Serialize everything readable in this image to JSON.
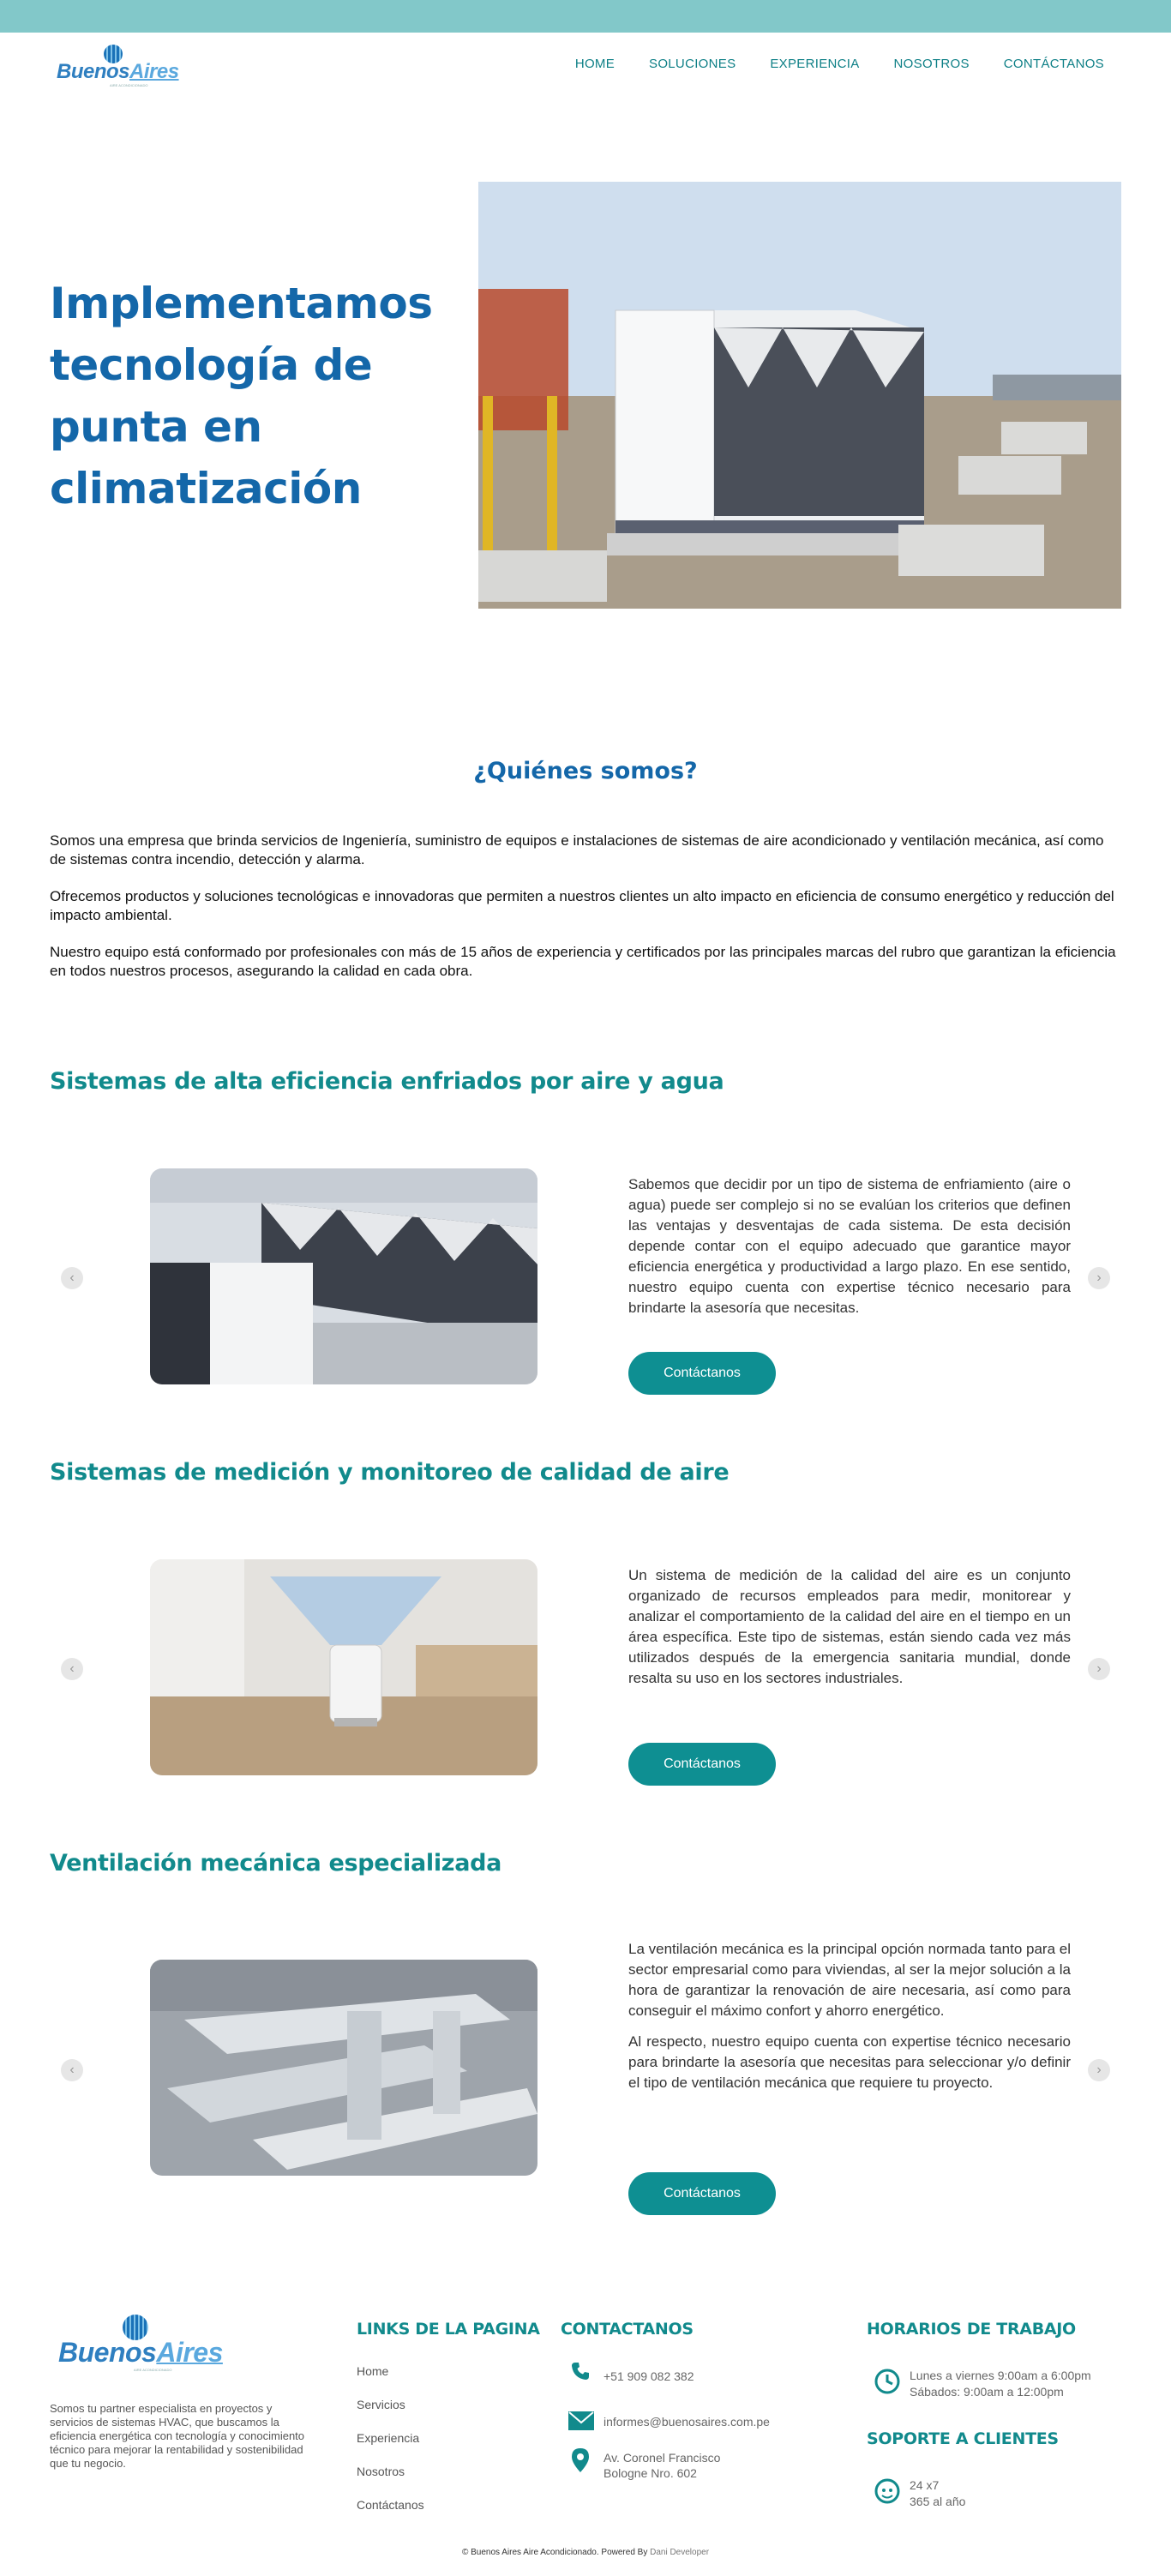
{
  "brand": {
    "name_part1": "Buenos",
    "name_part2": "Aires",
    "tagline": "AIRE ACONDICIONADO"
  },
  "nav": {
    "items": [
      "HOME",
      "SOLUCIONES",
      "EXPERIENCIA",
      "NOSOTROS",
      "CONTÁCTANOS"
    ]
  },
  "hero": {
    "title": "Implementamos tecnología de punta en climatización"
  },
  "about": {
    "title": "¿Quiénes somos?",
    "paragraphs": [
      "Somos una empresa que brinda servicios de Ingeniería, suministro de equipos e instalaciones de sistemas de aire acondicionado y ventilación mecánica, así como de sistemas contra incendio, detección y alarma.",
      "Ofrecemos productos y soluciones tecnológicas e innovadoras que permiten a nuestros clientes un alto impacto en eficiencia de consumo energético y reducción del impacto ambiental.",
      "Nuestro equipo está conformado por profesionales con más de 15 años de experiencia y certificados por las principales marcas del rubro que garantizan la eficiencia en todos nuestros procesos, asegurando la calidad en cada obra."
    ]
  },
  "sections": [
    {
      "title": "Sistemas de alta eficiencia enfriados por aire y agua",
      "paragraphs": [
        "Sabemos que decidir por un tipo de sistema de enfriamiento (aire o agua) puede ser complejo si no se evalúan los criterios que definen las ventajas y desventajas de cada sistema. De esta decisión depende contar con el equipo adecuado que garantice mayor eficiencia energética y productividad a largo plazo. En ese sentido, nuestro equipo cuenta con expertise técnico necesario para brindarte la asesoría que necesitas."
      ],
      "button": "Contáctanos"
    },
    {
      "title": "Sistemas de medición y monitoreo de calidad de aire",
      "paragraphs": [
        "Un sistema de medición de la calidad del aire es un conjunto organizado de recursos empleados para medir, monitorear y analizar el comportamiento de la calidad del aire en el tiempo en un área específica. Este tipo de sistemas, están siendo cada vez más utilizados después de la emergencia sanitaria mundial, donde resalta su uso en los sectores industriales."
      ],
      "button": "Contáctanos"
    },
    {
      "title": "Ventilación mecánica especializada",
      "paragraphs": [
        "La ventilación mecánica es la principal opción normada tanto para el sector empresarial como para viviendas, al ser la mejor solución a la hora de garantizar la renovación de aire necesaria, así como para conseguir el máximo confort y ahorro energético.",
        "Al respecto, nuestro equipo cuenta con expertise técnico necesario para brindarte la asesoría que necesitas para seleccionar y/o definir el tipo de ventilación mecánica que requiere tu proyecto."
      ],
      "button": "Contáctanos"
    }
  ],
  "slider": {
    "prev": "‹",
    "next": "›"
  },
  "footer": {
    "description": "Somos tu partner especialista en proyectos y servicios de sistemas HVAC, que buscamos la eficiencia energética con tecnología y conocimiento técnico para mejorar la rentabilidad y sostenibilidad que tu negocio.",
    "links_title": "LINKS DE LA PAGINA",
    "links": [
      "Home",
      "Servicios",
      "Experiencia",
      "Nosotros",
      "Contáctanos"
    ],
    "contact_title": "CONTACTANOS",
    "phone": "+51 909 082 382",
    "email": "informes@buenosaires.com.pe",
    "address": "Av. Coronel Francisco Bologne Nro. 602",
    "hours_title": "HORARIOS DE TRABAJO",
    "hours_weekday": "Lunes a viernes 9:00am a 6:00pm",
    "hours_saturday": "Sábados: 9:00am a 12:00pm",
    "support_title": "SOPORTE A CLIENTES",
    "support_line1": "24 x7",
    "support_line2": "365 al año",
    "copyright": "© Buenos Aires Aire Acondicionado. Powered By",
    "developer": "Dani Developer"
  },
  "colors": {
    "topbar": "#82c8c9",
    "primary_blue": "#1467a9",
    "teal": "#118a8c",
    "button": "#0e8f92"
  }
}
